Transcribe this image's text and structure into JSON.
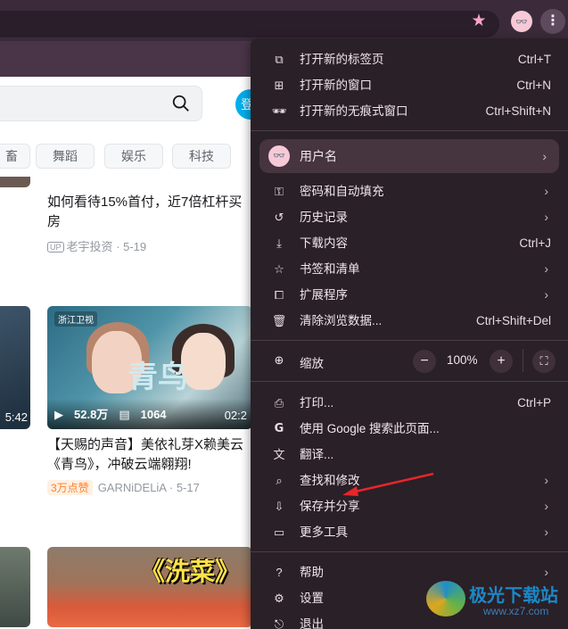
{
  "toolbar": {
    "star_icon": "star-icon",
    "avatar_glyph": "👓",
    "menu_glyph": "⋮"
  },
  "page": {
    "login_label": "登",
    "chips": [
      "畜",
      "舞蹈",
      "娱乐",
      "科技"
    ],
    "cards": [
      {
        "title": "如何看待15%首付，近7倍杠杆买房",
        "up_tag": "UP",
        "author": "老宇投资",
        "date": "5-19"
      },
      {
        "title": "【天赐的声音】美依礼芽X赖美云《青鸟》，冲破云端翱翔!",
        "hot_badge": "3万点赞",
        "author": "GARNiDELiA",
        "date": "5-17",
        "views": "52.8万",
        "danmaku": "1064",
        "duration_partial": "02:2",
        "thumb_logo": "浙江卫视",
        "thumb_text": "青鸟"
      }
    ],
    "left_duration": "5:42",
    "bottom_thumb_text": "《洗菜》"
  },
  "menu": {
    "items_top": [
      {
        "icon": "⧉",
        "label": "打开新的标签页",
        "shortcut": "Ctrl+T"
      },
      {
        "icon": "⊞",
        "label": "打开新的窗口",
        "shortcut": "Ctrl+N"
      },
      {
        "icon": "🕶",
        "label": "打开新的无痕式窗口",
        "shortcut": "Ctrl+Shift+N"
      }
    ],
    "profile": {
      "avatar": "👓",
      "label": "用户名"
    },
    "items_mid": [
      {
        "icon": "⚿",
        "label": "密码和自动填充",
        "submenu": true
      },
      {
        "icon": "↺",
        "label": "历史记录",
        "submenu": true
      },
      {
        "icon": "⤓",
        "label": "下载内容",
        "shortcut": "Ctrl+J"
      },
      {
        "icon": "☆",
        "label": "书签和清单",
        "submenu": true
      },
      {
        "icon": "⧠",
        "label": "扩展程序",
        "submenu": true
      },
      {
        "icon": "🗑",
        "label": "清除浏览数据...",
        "shortcut": "Ctrl+Shift+Del"
      }
    ],
    "zoom": {
      "icon": "⊕",
      "label": "缩放",
      "minus": "−",
      "value": "100%",
      "plus": "+",
      "fullscreen": "⛶"
    },
    "items_bottom": [
      {
        "icon": "⎙",
        "label": "打印...",
        "shortcut": "Ctrl+P"
      },
      {
        "icon": "G",
        "label": "使用 Google 搜索此页面..."
      },
      {
        "icon": "文",
        "label": "翻译..."
      },
      {
        "icon": "⌕",
        "label": "查找和修改",
        "submenu": true
      },
      {
        "icon": "⇩",
        "label": "保存并分享",
        "submenu": true
      },
      {
        "icon": "▭",
        "label": "更多工具",
        "submenu": true
      }
    ],
    "items_last": [
      {
        "icon": "?",
        "label": "帮助",
        "submenu": true
      },
      {
        "icon": "⚙",
        "label": "设置"
      },
      {
        "icon": "⎋",
        "label": "退出"
      }
    ],
    "chevron": "›"
  },
  "watermark": {
    "title": "极光下载站",
    "url": "www.xz7.com"
  },
  "colors": {
    "chrome_bg": "#3b2b3a",
    "menu_bg": "#2a2027",
    "accent_pink": "#f6a3c6",
    "arrow_red": "#e5262a"
  }
}
